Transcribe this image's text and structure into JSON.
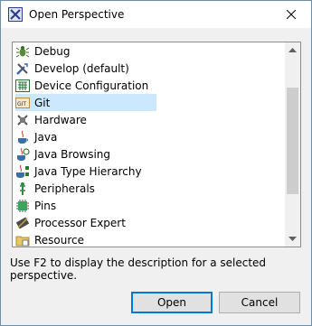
{
  "window": {
    "title": "Open Perspective"
  },
  "list": {
    "items": [
      {
        "label": "Debug",
        "icon": "debug-icon"
      },
      {
        "label": "Develop (default)",
        "icon": "develop-icon"
      },
      {
        "label": "Device Configuration",
        "icon": "device-config-icon"
      },
      {
        "label": "Git",
        "icon": "git-icon",
        "selected": true
      },
      {
        "label": "Hardware",
        "icon": "hardware-icon"
      },
      {
        "label": "Java",
        "icon": "java-icon"
      },
      {
        "label": "Java Browsing",
        "icon": "java-browsing-icon"
      },
      {
        "label": "Java Type Hierarchy",
        "icon": "java-hierarchy-icon"
      },
      {
        "label": "Peripherals",
        "icon": "peripherals-icon"
      },
      {
        "label": "Pins",
        "icon": "pins-icon"
      },
      {
        "label": "Processor Expert",
        "icon": "processor-expert-icon"
      },
      {
        "label": "Resource",
        "icon": "resource-icon"
      }
    ]
  },
  "description": "Use F2 to display the description for a selected perspective.",
  "buttons": {
    "open": "Open",
    "cancel": "Cancel"
  },
  "colors": {
    "selection": "#cce8ff",
    "accent": "#0078d7"
  }
}
